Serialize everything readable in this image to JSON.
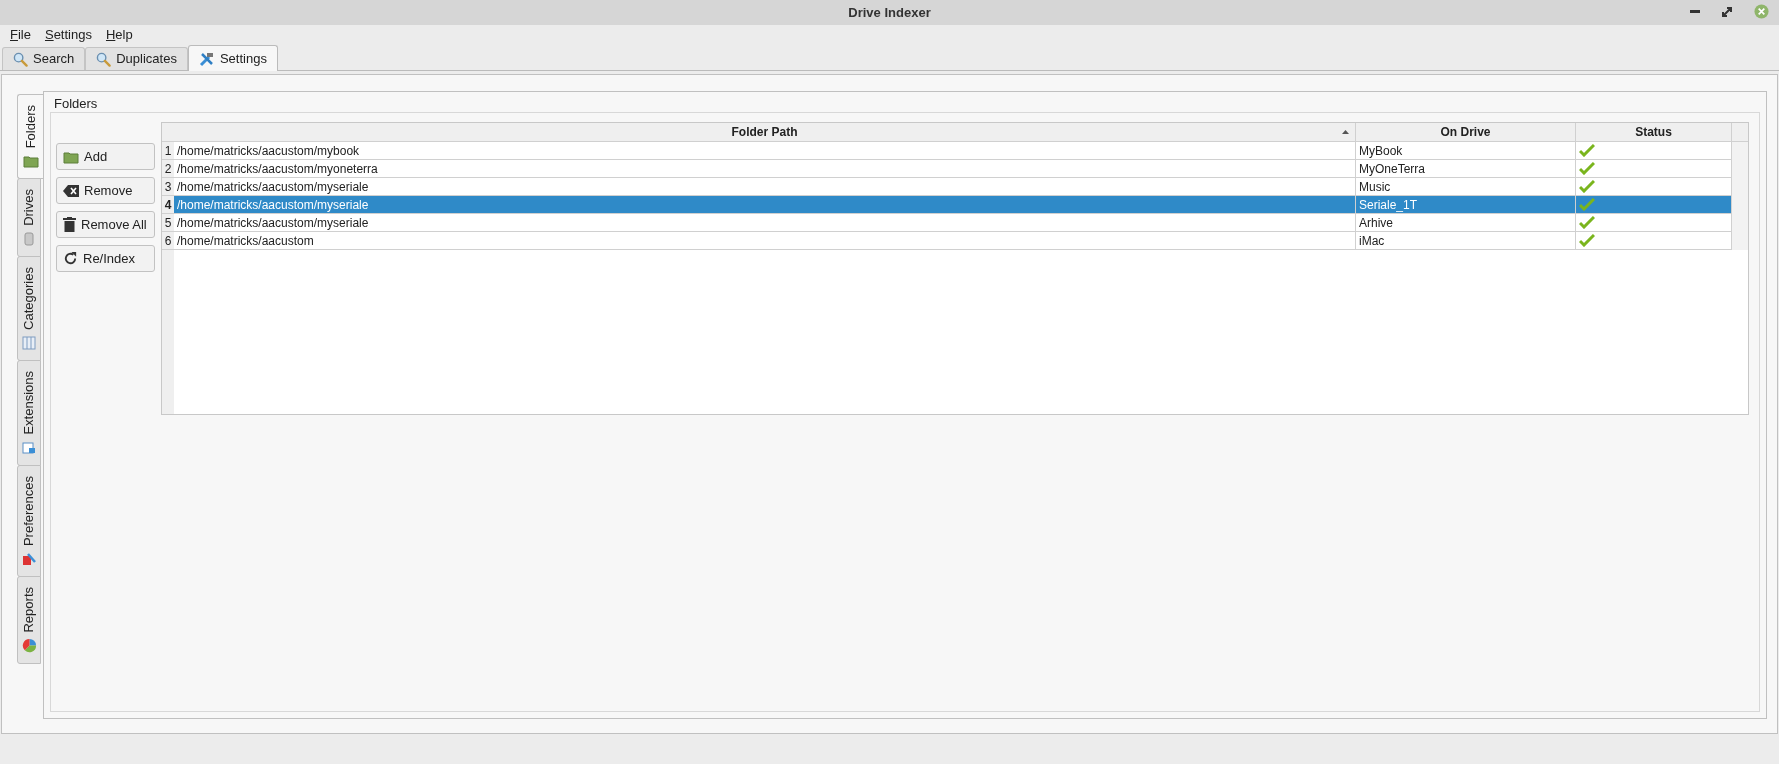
{
  "window": {
    "title": "Drive Indexer"
  },
  "menu": [
    "File",
    "Settings",
    "Help"
  ],
  "tabs": [
    {
      "label": "Search",
      "selected": false
    },
    {
      "label": "Duplicates",
      "selected": false
    },
    {
      "label": "Settings",
      "selected": true
    }
  ],
  "side_tabs": [
    {
      "label": "Folders",
      "selected": true
    },
    {
      "label": "Drives",
      "selected": false
    },
    {
      "label": "Categories",
      "selected": false
    },
    {
      "label": "Extensions",
      "selected": false
    },
    {
      "label": "Preferences",
      "selected": false
    },
    {
      "label": "Reports",
      "selected": false
    }
  ],
  "section_title": "Folders",
  "buttons": [
    "Add",
    "Remove",
    "Remove All",
    "Re/Index"
  ],
  "table": {
    "columns": [
      "Folder Path",
      "On Drive",
      "Status"
    ],
    "rows": [
      {
        "number": "1",
        "path": "/home/matricks/aacustom/mybook",
        "drive": "MyBook",
        "ok": true,
        "selected": false
      },
      {
        "number": "2",
        "path": "/home/matricks/aacustom/myoneterra",
        "drive": "MyOneTerra",
        "ok": true,
        "selected": false
      },
      {
        "number": "3",
        "path": "/home/matricks/aacustom/myseriale",
        "drive": "Music",
        "ok": true,
        "selected": false
      },
      {
        "number": "4",
        "path": "/home/matricks/aacustom/myseriale",
        "drive": "Seriale_1T",
        "ok": true,
        "selected": true
      },
      {
        "number": "5",
        "path": "/home/matricks/aacustom/myseriale",
        "drive": "Arhive",
        "ok": true,
        "selected": false
      },
      {
        "number": "6",
        "path": "/home/matricks/aacustom",
        "drive": "iMac",
        "ok": true,
        "selected": false
      }
    ]
  }
}
